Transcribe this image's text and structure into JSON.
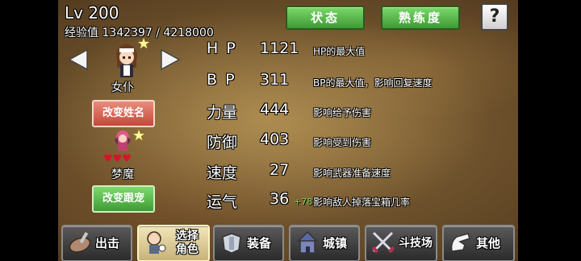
{
  "player": {
    "level_text": "Lv 200",
    "exp_text": "经验值 1342397 / 4218000"
  },
  "top_buttons": {
    "status": "状态",
    "proficiency": "熟练度",
    "help": "?"
  },
  "character": {
    "name": "女仆",
    "rename_button": "改变姓名"
  },
  "pet": {
    "name": "梦魔",
    "hearts": "♥♥♥",
    "change_button": "改变跟宠"
  },
  "stats": [
    {
      "label": "H P",
      "value": "1121",
      "bonus": "",
      "desc": "HP的最大值"
    },
    {
      "label": "B P",
      "value": "311",
      "bonus": "",
      "desc": "BP的最大值，影响回复速度"
    },
    {
      "label": "力量",
      "value": "444",
      "bonus": "",
      "desc": "影响给予伤害"
    },
    {
      "label": "防御",
      "value": "403",
      "bonus": "",
      "desc": "影响受到伤害"
    },
    {
      "label": "速度",
      "value": "27",
      "bonus": "",
      "desc": "影响武器准备速度"
    },
    {
      "label": "运气",
      "value": "36",
      "bonus": "+78",
      "desc": "影响敌人掉落宝箱几率"
    }
  ],
  "nav": [
    {
      "label": "出击",
      "icon": "sortie-icon"
    },
    {
      "label": "选择角色",
      "icon": "select-character-icon"
    },
    {
      "label": "装备",
      "icon": "equipment-icon"
    },
    {
      "label": "城镇",
      "icon": "town-icon"
    },
    {
      "label": "斗技场",
      "icon": "arena-icon"
    },
    {
      "label": "其他",
      "icon": "other-icon"
    }
  ],
  "colors": {
    "green_button": "#3e9a33",
    "red_button": "#c3483a",
    "bonus_text": "#7cd35a",
    "heart": "#d8132b",
    "star": "#fff7a0"
  }
}
